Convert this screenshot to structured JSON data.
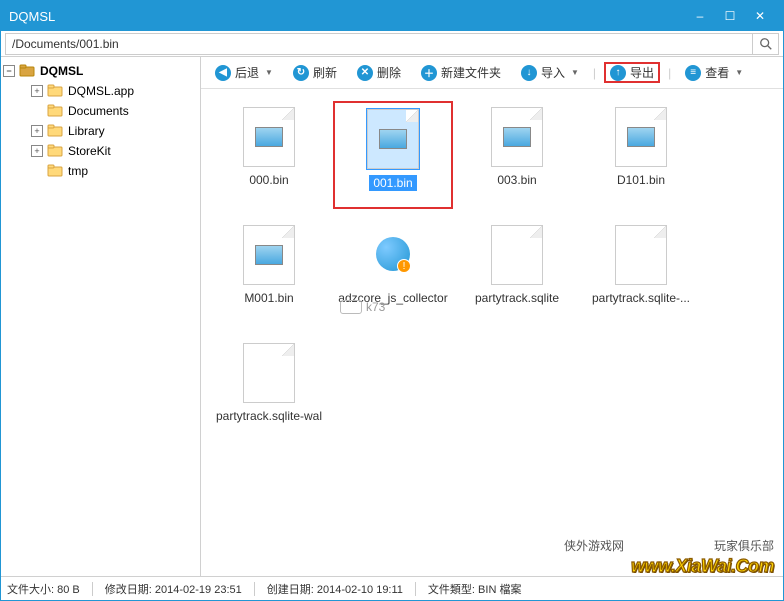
{
  "window": {
    "title": "DQMSL"
  },
  "path": "/Documents/001.bin",
  "tree": {
    "root": "DQMSL",
    "items": [
      {
        "label": "DQMSL.app",
        "expandable": true
      },
      {
        "label": "Documents",
        "expandable": false
      },
      {
        "label": "Library",
        "expandable": true
      },
      {
        "label": "StoreKit",
        "expandable": true
      },
      {
        "label": "tmp",
        "expandable": false
      }
    ]
  },
  "toolbar": {
    "back": "后退",
    "refresh": "刷新",
    "delete": "删除",
    "newfolder": "新建文件夹",
    "import": "导入",
    "export": "导出",
    "view": "查看"
  },
  "files": [
    {
      "name": "000.bin",
      "type": "bin"
    },
    {
      "name": "001.bin",
      "type": "bin",
      "selected": true
    },
    {
      "name": "003.bin",
      "type": "bin"
    },
    {
      "name": "D101.bin",
      "type": "bin"
    },
    {
      "name": "M001.bin",
      "type": "bin"
    },
    {
      "name": "adzcore_js_collector",
      "type": "qq"
    },
    {
      "name": "partytrack.sqlite",
      "type": "blank"
    },
    {
      "name": "partytrack.sqlite-...",
      "type": "blank"
    },
    {
      "name": "partytrack.sqlite-wal",
      "type": "blank"
    }
  ],
  "status": {
    "size_label": "文件大小:",
    "size_value": "80 B",
    "modify_label": "修改日期:",
    "modify_value": "2014-02-19 23:51",
    "create_label": "创建日期:",
    "create_value": "2014-02-10 19:11",
    "type_label": "文件類型:",
    "type_value": "BIN 檔案"
  },
  "watermark": {
    "text1": "侠外游戏网",
    "text2": "玩家俱乐部",
    "logo": "www.XiaWai.Com",
    "center": "k73"
  }
}
